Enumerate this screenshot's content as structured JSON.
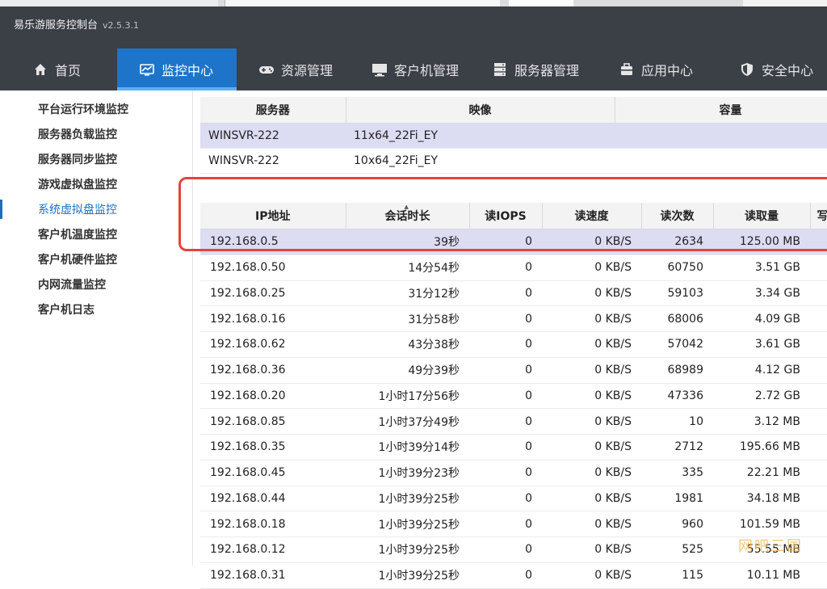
{
  "app": {
    "title": "易乐游服务控制台",
    "version": "v2.5.3.1"
  },
  "nav": {
    "tabs": [
      {
        "label": "首页",
        "icon": "home-icon"
      },
      {
        "label": "监控中心",
        "icon": "monitor-chart-icon",
        "active": true
      },
      {
        "label": "资源管理",
        "icon": "gamepad-icon"
      },
      {
        "label": "客户机管理",
        "icon": "desktop-icon"
      },
      {
        "label": "服务器管理",
        "icon": "server-icon"
      },
      {
        "label": "应用中心",
        "icon": "app-box-icon"
      },
      {
        "label": "安全中心",
        "icon": "shield-icon"
      }
    ]
  },
  "sidebar": {
    "items": [
      {
        "label": "平台运行环境监控"
      },
      {
        "label": "服务器负载监控"
      },
      {
        "label": "服务器同步监控"
      },
      {
        "label": "游戏虚拟盘监控"
      },
      {
        "label": "系统虚拟盘监控",
        "active": true
      },
      {
        "label": "客户机温度监控"
      },
      {
        "label": "客户机硬件监控"
      },
      {
        "label": "内网流量监控"
      },
      {
        "label": "客户机日志"
      }
    ]
  },
  "servers": {
    "headers": [
      "服务器",
      "映像",
      "容量"
    ],
    "rows": [
      {
        "server": "WINSVR-222",
        "image": "11x64_22Fi_EY",
        "capacity": ""
      },
      {
        "server": "WINSVR-222",
        "image": "10x64_22Fi_EY",
        "capacity": ""
      }
    ]
  },
  "sessions": {
    "headers": [
      "IP地址",
      "会话时长",
      "读IOPS",
      "读速度",
      "读次数",
      "读取量",
      "写"
    ],
    "rows": [
      {
        "ip": "192.168.0.5",
        "duration": "39秒",
        "iops": "0",
        "speed": "0 KB/S",
        "count": "2634",
        "amount": "125.00 MB"
      },
      {
        "ip": "192.168.0.50",
        "duration": "14分54秒",
        "iops": "0",
        "speed": "0 KB/S",
        "count": "60750",
        "amount": "3.51 GB"
      },
      {
        "ip": "192.168.0.25",
        "duration": "31分12秒",
        "iops": "0",
        "speed": "0 KB/S",
        "count": "59103",
        "amount": "3.34 GB"
      },
      {
        "ip": "192.168.0.16",
        "duration": "31分58秒",
        "iops": "0",
        "speed": "0 KB/S",
        "count": "68006",
        "amount": "4.09 GB"
      },
      {
        "ip": "192.168.0.62",
        "duration": "43分38秒",
        "iops": "0",
        "speed": "0 KB/S",
        "count": "57042",
        "amount": "3.61 GB"
      },
      {
        "ip": "192.168.0.36",
        "duration": "49分39秒",
        "iops": "0",
        "speed": "0 KB/S",
        "count": "68989",
        "amount": "4.12 GB"
      },
      {
        "ip": "192.168.0.20",
        "duration": "1小时17分56秒",
        "iops": "0",
        "speed": "0 KB/S",
        "count": "47336",
        "amount": "2.72 GB"
      },
      {
        "ip": "192.168.0.85",
        "duration": "1小时37分49秒",
        "iops": "0",
        "speed": "0 KB/S",
        "count": "10",
        "amount": "3.12 MB"
      },
      {
        "ip": "192.168.0.35",
        "duration": "1小时39分14秒",
        "iops": "0",
        "speed": "0 KB/S",
        "count": "2712",
        "amount": "195.66 MB"
      },
      {
        "ip": "192.168.0.45",
        "duration": "1小时39分23秒",
        "iops": "0",
        "speed": "0 KB/S",
        "count": "335",
        "amount": "22.21 MB"
      },
      {
        "ip": "192.168.0.44",
        "duration": "1小时39分25秒",
        "iops": "0",
        "speed": "0 KB/S",
        "count": "1981",
        "amount": "34.18 MB"
      },
      {
        "ip": "192.168.0.18",
        "duration": "1小时39分25秒",
        "iops": "0",
        "speed": "0 KB/S",
        "count": "960",
        "amount": "101.59 MB"
      },
      {
        "ip": "192.168.0.12",
        "duration": "1小时39分25秒",
        "iops": "0",
        "speed": "0 KB/S",
        "count": "525",
        "amount": "55.55 MB"
      },
      {
        "ip": "192.168.0.31",
        "duration": "1小时39分25秒",
        "iops": "0",
        "speed": "0 KB/S",
        "count": "115",
        "amount": "10.11 MB"
      }
    ]
  },
  "watermark": "网吧三国",
  "colors": {
    "header_bg": "#3b3f46",
    "active_tab": "#1d74c9",
    "selected_row": "#dcdcf3",
    "highlight_border": "#e4443e",
    "sidebar_active": "#1b6fc1"
  }
}
